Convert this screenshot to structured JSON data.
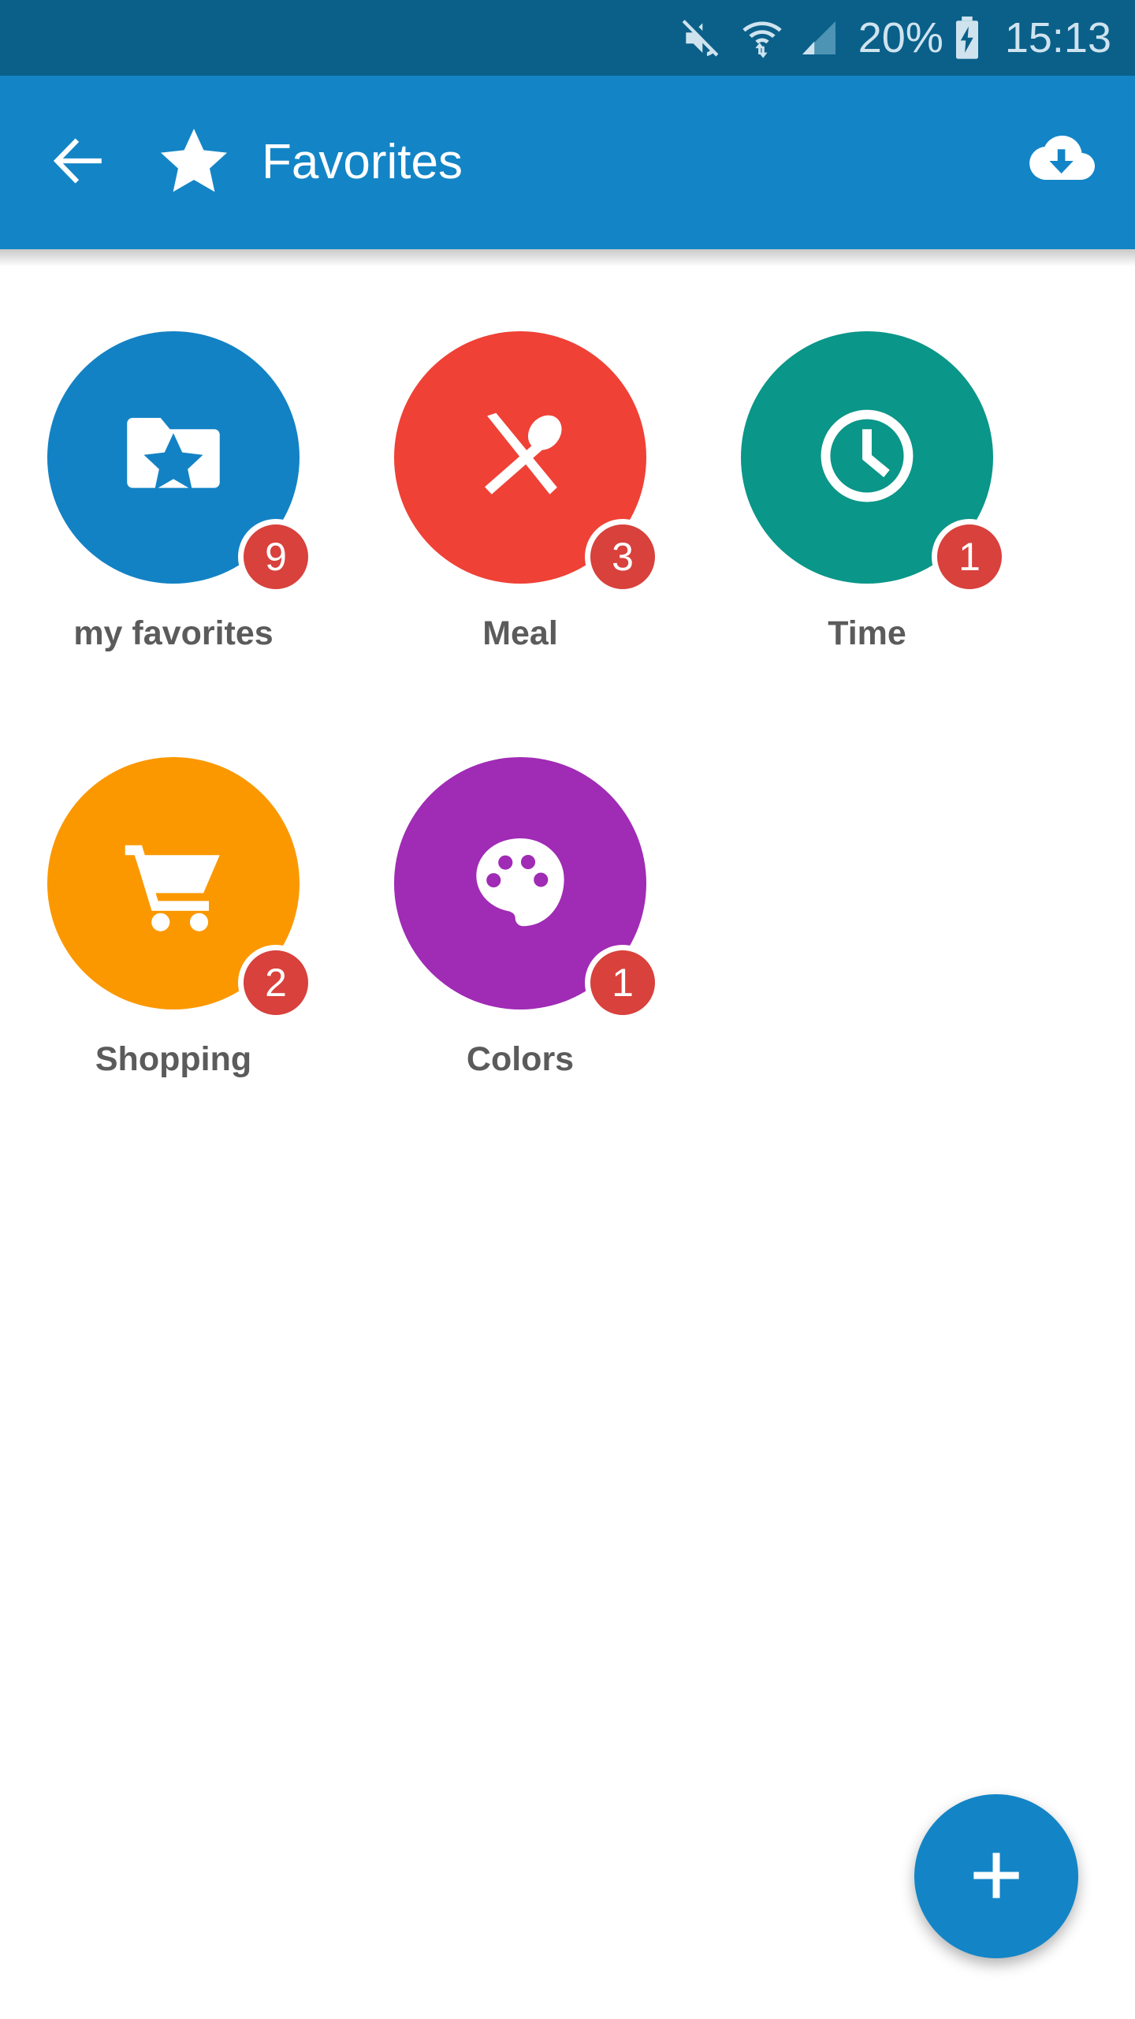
{
  "status_bar": {
    "background_color": "#0a6089",
    "text_color": "#cfe3ef",
    "battery_percent": "20%",
    "clock": "15:13",
    "icons": [
      "mute-icon",
      "wifi-icon",
      "signal-icon",
      "battery-charging-icon"
    ]
  },
  "app_bar": {
    "background_color": "#1385c6",
    "back_icon": "back-arrow-icon",
    "leading_icon": "star-icon",
    "title": "Favorites",
    "action_icon": "cloud-download-icon"
  },
  "grid": {
    "items": [
      {
        "label": "my favorites",
        "badge": "9",
        "color": "#1382c4",
        "icon": "folder-star-icon"
      },
      {
        "label": "Meal",
        "badge": "3",
        "color": "#ef4136",
        "icon": "cutlery-icon"
      },
      {
        "label": "Time",
        "badge": "1",
        "color": "#0a9688",
        "icon": "clock-icon"
      },
      {
        "label": "Shopping",
        "badge": "2",
        "color": "#fb9800",
        "icon": "shopping-cart-icon"
      },
      {
        "label": "Colors",
        "badge": "1",
        "color": "#a02bb5",
        "icon": "palette-icon"
      }
    ],
    "badge_color": "#d8413c",
    "label_color": "#5b5b5b"
  },
  "fab": {
    "icon": "plus-icon",
    "color": "#1385c6",
    "label": "+"
  }
}
